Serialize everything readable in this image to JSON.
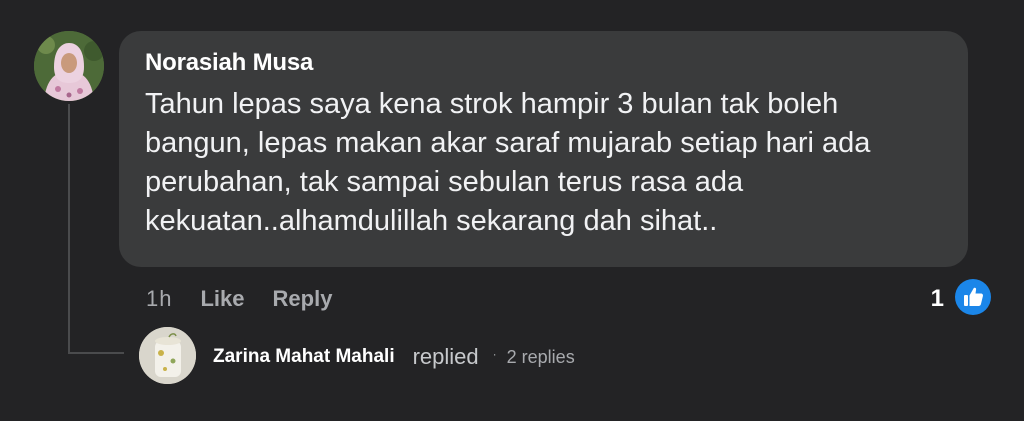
{
  "comment": {
    "author": "Norasiah Musa",
    "text": "Tahun lepas saya kena strok hampir 3 bulan tak boleh bangun, lepas makan akar saraf mujarab setiap hari ada perubahan, tak sampai sebulan terus rasa ada kekuatan..alhamdulillah sekarang dah sihat..",
    "time": "1h",
    "like_label": "Like",
    "reply_label": "Reply",
    "reaction_count": "1",
    "reaction_icon": "thumbs-up-icon"
  },
  "reply_summary": {
    "author": "Zarina Mahat Mahali",
    "verb": "replied",
    "separator": "·",
    "count_label": "2 replies"
  },
  "colors": {
    "background": "#232325",
    "bubble": "#3a3b3c",
    "like_badge": "#1b86e9",
    "meta_text": "#a8aaae"
  }
}
